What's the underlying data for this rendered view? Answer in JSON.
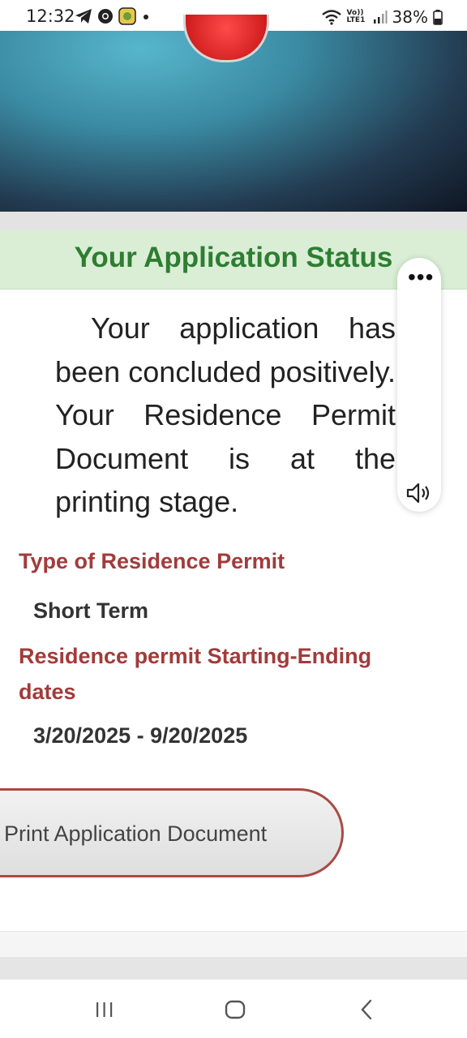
{
  "status_bar": {
    "time": "12:32",
    "battery": "38%",
    "icons": [
      "telegram-icon",
      "chrome-icon",
      "app-icon",
      "dot-icon",
      "wifi-icon",
      "volte-icon",
      "signal-icon",
      "battery-icon"
    ],
    "volte_label": "Vo)) LTE1"
  },
  "status_header": {
    "title": "Your Application Status"
  },
  "message": "Your application has been concluded positively. Your Residence Permit Document is at the printing stage.",
  "permit": {
    "type_label": "Type of Residence Permit",
    "type_value": "Short Term",
    "dates_label": "Residence permit Starting-Ending dates",
    "dates_value": "3/20/2025 - 9/20/2025"
  },
  "print_button": {
    "label": "Print Application Document"
  },
  "floating_panel": {
    "icons": [
      "more-icon",
      "speaker-icon"
    ]
  },
  "nav": {
    "icons": [
      "recent-apps-icon",
      "home-icon",
      "back-icon"
    ]
  },
  "colors": {
    "status_green": "#2e7d32",
    "label_red": "#a23b3b",
    "header_bg": "#d9eed5"
  }
}
